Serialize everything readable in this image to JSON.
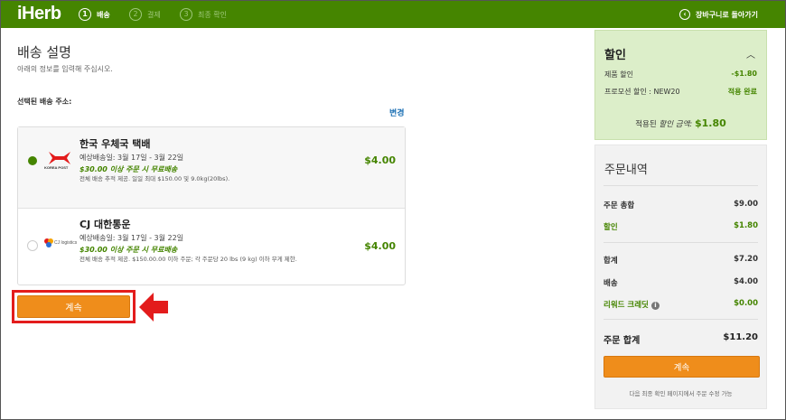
{
  "header": {
    "logo": "iHerb",
    "steps": [
      {
        "num": "1",
        "label": "배송"
      },
      {
        "num": "2",
        "label": "결제"
      },
      {
        "num": "3",
        "label": "최종 확인"
      }
    ],
    "back_label": "장바구니로 돌아가기"
  },
  "main": {
    "title": "배송 설명",
    "subtitle": "아래의 정보를 입력해 주십시오.",
    "address_label": "선택된 배송 주소:",
    "change_label": "변경",
    "options": [
      {
        "name": "한국 우체국 택배",
        "date": "예상배송일: 3월 17일 - 3월 22일",
        "free": "$30.00 이상 주문 시 무료배송",
        "note": "전체 배송 추적 제공. 일일 최대 $150.00 및 9.0kg(20lbs).",
        "price": "$4.00",
        "logo_text": "KOREA POST",
        "selected": true
      },
      {
        "name": "CJ 대한통운",
        "date": "예상배송일: 3월 17일 - 3월 22일",
        "free": "$30.00 이상 주문 시 무료배송",
        "note": "전체 배송 추적 제공. $150.00.00 이하 주문; 각 주문당 20 lbs (9 kg) 이하 무게 제한.",
        "price": "$4.00",
        "logo_text": "CJ logistics",
        "selected": false
      }
    ],
    "continue_label": "계속"
  },
  "discount": {
    "title": "할인",
    "rows": [
      {
        "label": "제품 할인",
        "value": "-$1.80"
      },
      {
        "label": "프로모션 할인 : NEW20",
        "value": "적용 완료"
      }
    ],
    "total_prefix": "적용된 ",
    "total_italic": "할인 금액:",
    "total_amount": "$1.80"
  },
  "summary": {
    "title": "주문내역",
    "rows": [
      {
        "label": "주문 총합",
        "value": "$9.00"
      },
      {
        "label": "할인",
        "value": "$1.80"
      },
      {
        "label": "합계",
        "value": "$7.20"
      },
      {
        "label": "배송",
        "value": "$4.00"
      },
      {
        "label": "리워드 크레딧",
        "value": "$0.00"
      }
    ],
    "grand_label": "주문 합계",
    "grand_value": "$11.20",
    "button_label": "계속",
    "note": "다음 최종 확인 페이지에서 주문 수정 가능"
  },
  "colors": {
    "brand_green": "#458500",
    "accent_orange": "#ef8d1b",
    "highlight_red": "#e31c1c"
  }
}
